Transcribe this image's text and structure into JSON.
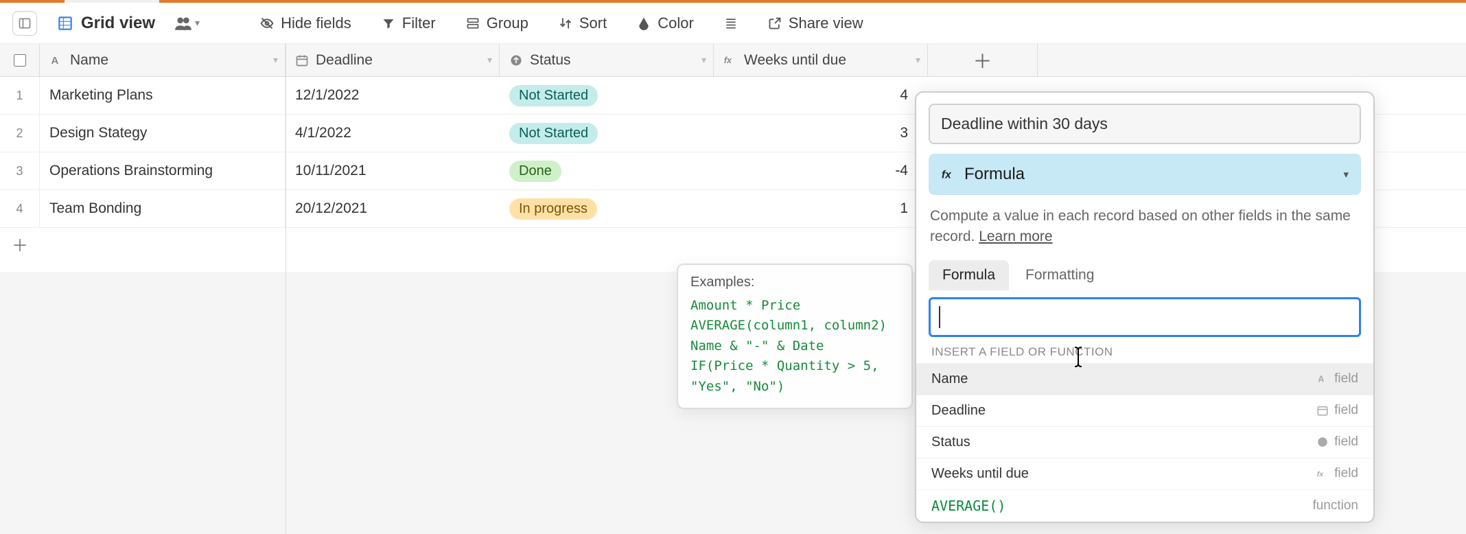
{
  "toolbar": {
    "view_name": "Grid view",
    "hide_fields": "Hide fields",
    "filter": "Filter",
    "group": "Group",
    "sort": "Sort",
    "color": "Color",
    "share": "Share view"
  },
  "columns": {
    "name": "Name",
    "deadline": "Deadline",
    "status": "Status",
    "weeks": "Weeks until due"
  },
  "rows": [
    {
      "n": "1",
      "name": "Marketing Plans",
      "deadline": "12/1/2022",
      "status": "Not Started",
      "status_style": "teal",
      "weeks": "4"
    },
    {
      "n": "2",
      "name": "Design Stategy",
      "deadline": "4/1/2022",
      "status": "Not Started",
      "status_style": "teal",
      "weeks": "3"
    },
    {
      "n": "3",
      "name": "Operations Brainstorming",
      "deadline": "10/11/2021",
      "status": "Done",
      "status_style": "green",
      "weeks": "-4"
    },
    {
      "n": "4",
      "name": "Team Bonding",
      "deadline": "20/12/2021",
      "status": "In progress",
      "status_style": "yellow",
      "weeks": "1"
    }
  ],
  "examples": {
    "title": "Examples:",
    "lines": "Amount * Price\nAVERAGE(column1, column2)\nName & \"-\" & Date\nIF(Price * Quantity > 5,\n\"Yes\", \"No\")"
  },
  "panel": {
    "field_name": "Deadline within 30 days",
    "type_label": "Formula",
    "description_a": "Compute a value in each record based on other fields in the same record. ",
    "learn_more": "Learn more",
    "tabs": {
      "formula": "Formula",
      "formatting": "Formatting"
    },
    "insert_label": "INSERT A FIELD OR FUNCTION",
    "field_suffix": "field",
    "function_suffix": "function",
    "items": [
      {
        "label": "Name",
        "kind": "field",
        "icon": "text"
      },
      {
        "label": "Deadline",
        "kind": "field",
        "icon": "date"
      },
      {
        "label": "Status",
        "kind": "field",
        "icon": "select"
      },
      {
        "label": "Weeks until due",
        "kind": "field",
        "icon": "formula"
      },
      {
        "label": "AVERAGE()",
        "kind": "function"
      }
    ]
  }
}
